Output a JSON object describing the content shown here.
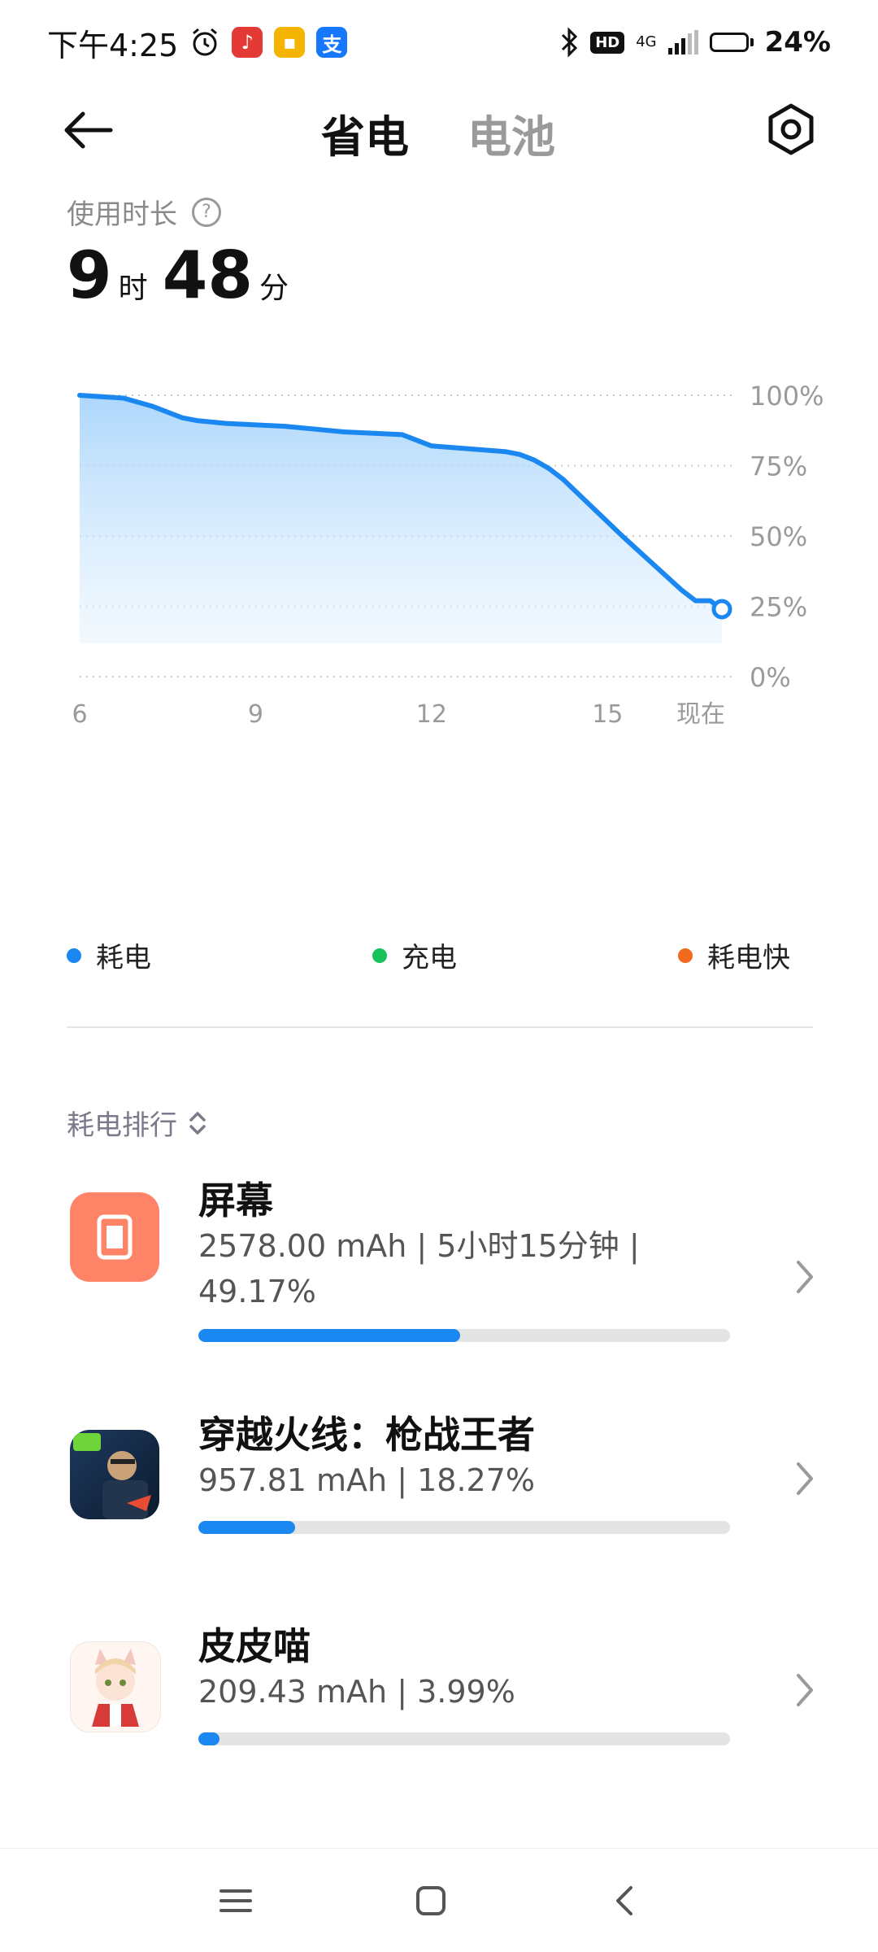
{
  "status_bar": {
    "time": "下午4:25",
    "alarm_icon": "alarm-clock-icon",
    "notif_icons": [
      "netease-music-icon",
      "notes-icon",
      "alipay-icon"
    ],
    "bluetooth_icon": "bluetooth-icon",
    "hd_label": "HD",
    "network_label": "4G",
    "battery_level": 0.24,
    "battery_percent": "24%"
  },
  "header": {
    "tabs": [
      {
        "label": "省电",
        "active": true
      },
      {
        "label": "电池",
        "active": false
      }
    ],
    "back_icon": "arrow-left-icon",
    "settings_icon": "settings-gear-icon"
  },
  "usage": {
    "label": "使用时长",
    "hours": "9",
    "hours_unit": "时",
    "minutes": "48",
    "minutes_unit": "分"
  },
  "chart_data": {
    "type": "area",
    "x": [
      6,
      6.75,
      7.25,
      7.75,
      8,
      8.5,
      9.5,
      10.5,
      11.5,
      12,
      13.25,
      13.5,
      13.75,
      14,
      14.25,
      14.75,
      15.25,
      16.25,
      16.5,
      16.75,
      16.95
    ],
    "y": [
      100,
      99,
      96,
      92,
      91,
      90,
      89,
      87,
      86,
      82,
      80,
      79,
      77,
      74,
      70,
      60,
      50,
      31,
      27,
      27,
      24
    ],
    "x_ticks": [
      "6",
      "9",
      "12",
      "15",
      "现在"
    ],
    "y_ticks": [
      "100%",
      "75%",
      "50%",
      "25%",
      "0%"
    ],
    "ylim": [
      0,
      100
    ],
    "series_color": "#1a88f0",
    "legend": [
      {
        "label": "耗电",
        "color": "#1a88f0"
      },
      {
        "label": "充电",
        "color": "#18c25a"
      },
      {
        "label": "耗电快",
        "color": "#f26a1b"
      }
    ]
  },
  "ranking": {
    "title": "耗电排行",
    "items": [
      {
        "name": "屏幕",
        "detail_line1": "2578.00 mAh | 5小时15分钟 |",
        "detail_line2": "49.17%",
        "share": 0.4917,
        "icon": "screen-icon"
      },
      {
        "name": "穿越火线：枪战王者",
        "detail_line1": "957.81 mAh | 18.27%",
        "share": 0.1827,
        "icon": "crossfire-game-icon"
      },
      {
        "name": "皮皮喵",
        "detail_line1": "209.43 mAh | 3.99%",
        "share": 0.0399,
        "icon": "pipimiao-app-icon"
      }
    ]
  },
  "nav": {
    "menu_icon": "menu-icon",
    "home_icon": "home-icon",
    "back_icon": "back-icon"
  }
}
